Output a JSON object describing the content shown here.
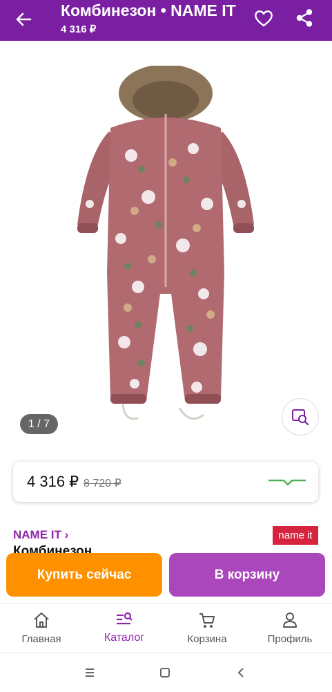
{
  "header": {
    "title": "Комбинезон • NAME IT",
    "price": "4 316 ₽"
  },
  "gallery": {
    "counter": "1 / 7"
  },
  "price_card": {
    "current": "4 316 ₽",
    "old": "8 720 ₽",
    "trend_color": "#4caf50"
  },
  "product": {
    "brand": "NAME IT ›",
    "brand_logo": "name it",
    "name": "Комбинезон"
  },
  "actions": {
    "buy_now": "Купить сейчас",
    "add_to_cart": "В корзину"
  },
  "bottom_nav": {
    "items": [
      {
        "label": "Главная",
        "icon": "home-icon"
      },
      {
        "label": "Каталог",
        "icon": "catalog-search-icon"
      },
      {
        "label": "Корзина",
        "icon": "cart-icon"
      },
      {
        "label": "Профиль",
        "icon": "profile-icon"
      }
    ]
  },
  "colors": {
    "brand": "#7b1fa2",
    "buy": "#ff9100",
    "cart": "#ab47bc"
  }
}
